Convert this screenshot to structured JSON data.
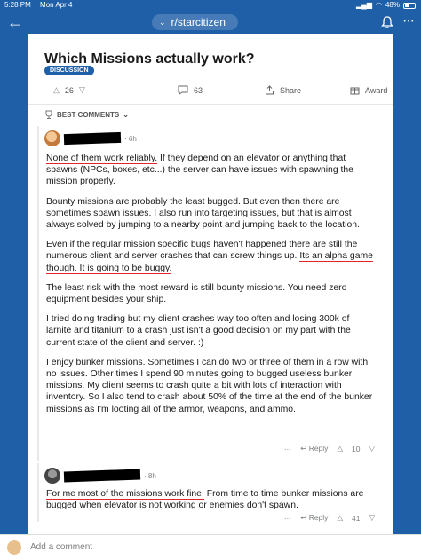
{
  "status": {
    "time": "5:28 PM",
    "date": "Mon Apr 4",
    "battery": "48%",
    "battery_level": 0.48
  },
  "nav": {
    "subreddit": "r/starcitizen"
  },
  "post": {
    "title": "Which Missions actually work?",
    "flair": "DISCUSSION",
    "votes": "26",
    "comments": "63",
    "share_label": "Share",
    "award_label": "Award"
  },
  "sort": {
    "label": "BEST COMMENTS"
  },
  "comments": [
    {
      "age": "6h",
      "paragraphs": [
        {
          "pre": "",
          "hl": "None of them work reliably.",
          "post": " If they depend on an elevator or anything that spawns (NPCs, boxes, etc...) the server can have issues with spawning the mission properly."
        },
        {
          "text": "Bounty missions are probably the least bugged. But even then there are sometimes spawn issues. I also run into targeting issues, but that is almost always solved by jumping to a nearby point and jumping back to the location."
        },
        {
          "pre": "Even if the regular mission specific bugs haven't happened there are still the numerous client and server crashes that can screw things up. ",
          "hl": "Its an alpha game though. It is going to be buggy.",
          "post": ""
        },
        {
          "text": "The least risk with the most reward is still bounty missions. You need zero equipment besides your ship."
        },
        {
          "text": "I tried doing trading but my client crashes way too often and losing 300k of larnite and titanium to a crash just isn't a good decision on my part with the current state of the client and server. :)"
        },
        {
          "text": "I enjoy bunker missions. Sometimes I can do two or three of them in a row with no issues. Other times I spend 90 minutes going to bugged useless bunker missions. My client seems to crash quite a bit with lots of interaction with inventory. So I also tend to crash about 50% of the time at the end of the bunker missions as I'm looting all of the armor, weapons, and ammo."
        }
      ],
      "reply_label": "Reply",
      "votes": "10"
    },
    {
      "age": "8h",
      "paragraphs": [
        {
          "pre": "",
          "hl": "For me most of the missions work fine.",
          "post": " From time to time bunker missions are bugged when elevator is not working or enemies don't spawn."
        }
      ],
      "reply_label": "Reply",
      "votes": "41"
    }
  ],
  "compose": {
    "placeholder": "Add a comment"
  },
  "colors": {
    "brand": "#1e5fa8",
    "flair": "#1e5fa8",
    "underline": "#e0262b"
  },
  "icons": [
    "back-arrow-icon",
    "chevron-down-icon",
    "bell-icon",
    "more-icon",
    "upvote-icon",
    "downvote-icon",
    "comment-icon",
    "share-icon",
    "award-icon",
    "trophy-icon",
    "reply-icon"
  ]
}
